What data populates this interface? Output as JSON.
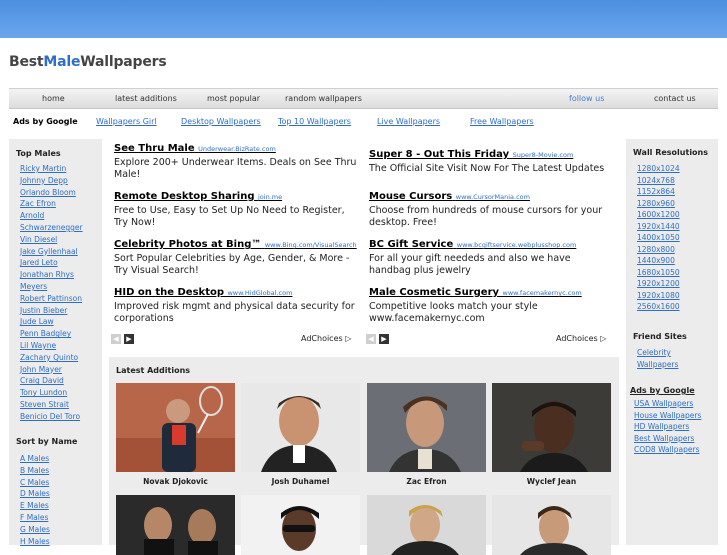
{
  "site": {
    "logo_part1": "Best",
    "logo_part2": "Male",
    "logo_part3": "Wallpapers"
  },
  "nav": {
    "home": "home",
    "latest": "latest additions",
    "popular": "most popular",
    "random": "random wallpapers",
    "follow": "follow us",
    "contact": "contact us"
  },
  "adsbar": {
    "label": "Ads by Google",
    "links": [
      "Wallpapers Girl",
      "Desktop Wallpapers",
      "Top 10 Wallpapers",
      "Live Wallpapers",
      "Free Wallpapers"
    ]
  },
  "left": {
    "top_males_title": "Top Males",
    "top_males": [
      "Ricky Martin",
      "Johnny Depp",
      "Orlando Bloom",
      "Zac Efron",
      "Arnold",
      "Schwarzenegger",
      "Vin Diesel",
      "Jake Gyllenhaal",
      "Jared Leto",
      "Jonathan Rhys",
      "Meyers",
      "Robert Pattinson",
      "Justin Bieber",
      "Jude Law",
      "Penn Badgley",
      "Lil Wayne",
      "Zachary Quinto",
      "John Mayer",
      "Craig David",
      "Tony Lundon",
      "Steven Strait",
      "Benicio Del Toro"
    ],
    "sort_title": "Sort by Name",
    "sort": [
      "A Males",
      "B Males",
      "C Males",
      "D Males",
      "E Males",
      "F Males",
      "G Males",
      "H Males"
    ]
  },
  "ads_left": [
    {
      "title": "See Thru Male",
      "url": "Underwear.BizRate.com",
      "desc": "Explore 200+ Underwear Items. Deals on See Thru Male!"
    },
    {
      "title": "Remote Desktop Sharing",
      "url": "join.me",
      "desc": "Free to Use, Easy to Set Up No Need to Register, Try Now!"
    },
    {
      "title": "Celebrity Photos at Bing™",
      "url": "www.Bing.com/VisualSearch",
      "desc": "Sort Popular Celebrities by Age, Gender, & More - Try Visual Search!"
    },
    {
      "title": "HID on the Desktop",
      "url": "www.HidGlobal.com",
      "desc": "Improved risk mgmt and physical data security for corporations"
    }
  ],
  "ads_right": [
    {
      "title": "Super 8 - Out This Friday",
      "url": "Super8-Movie.com",
      "desc": "The Official Site Visit Now For The Latest Updates"
    },
    {
      "title": "Mouse Cursors",
      "url": "www.CursorMania.com",
      "desc": "Choose from hundreds of mouse cursors for your desktop. Free!"
    },
    {
      "title": "BC Gift Service",
      "url": "www.bcgiftservice.webplusshop.com",
      "desc": "For all your gift neededs and also we have handbag plus jewelry"
    },
    {
      "title": "Male Cosmetic Surgery",
      "url": "www.facemakernyc.com",
      "desc": "Competitive looks match your style www.facemakernyc.com"
    }
  ],
  "adchoices": "AdChoices",
  "latest": {
    "title": "Latest Additions",
    "items": [
      "Novak Djokovic",
      "Josh Duhamel",
      "Zac Efron",
      "Wyclef Jean"
    ]
  },
  "right": {
    "res_title": "Wall Resolutions",
    "resolutions": [
      "1280x1024",
      "1024x768",
      "1152x864",
      "1280x960",
      "1600x1200",
      "1920x1440",
      "1400x1050",
      "1280x800",
      "1440x900",
      "1680x1050",
      "1920x1200",
      "1920x1080",
      "2560x1600"
    ],
    "friends_title": "Friend Sites",
    "friends": [
      "Celebrity",
      "Wallpapers"
    ],
    "ads_title": "Ads by Google",
    "ads": [
      "USA Wallpapers",
      "House Wallpapers",
      "HD Wallpapers",
      "Best Wallpapers",
      "COD8 Wallpapers"
    ]
  }
}
